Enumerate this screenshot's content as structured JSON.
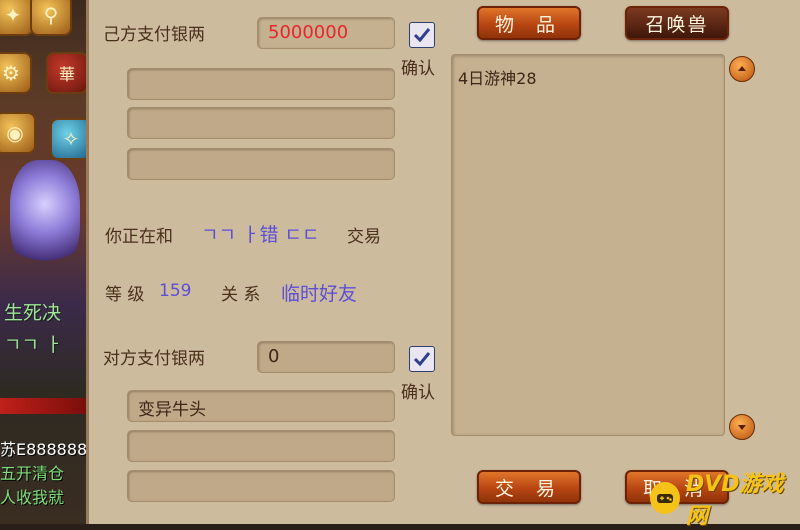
{
  "scene": {
    "text_shengsi": "生死决",
    "text_marks": "ㄱㄱ ㅏ",
    "chat_line1": "苏E888888",
    "chat_line2": "五开清仓",
    "chat_line3": "人收我就",
    "icons": [
      "bag-icon",
      "search-icon",
      "gear-icon",
      "ornament-icon",
      "orb-icon",
      "pet-icon"
    ]
  },
  "trade": {
    "my_silver_label": "己方支付银两",
    "my_silver_value": "5000000",
    "my_confirm_label": "确认",
    "my_confirm_checked": true,
    "trading_with_prefix": "你正在和",
    "partner_name": "ㄱㄱ ㅏ错 ㄷㄷ",
    "trading_with_suffix": "交易",
    "level_label": "等 级",
    "level_value": "159",
    "relation_label": "关 系",
    "relation_value": "临时好友",
    "their_silver_label": "对方支付银两",
    "their_silver_value": "0",
    "their_confirm_label": "确认",
    "their_confirm_checked": true,
    "their_items": [
      "变异牛头",
      "",
      ""
    ],
    "my_items": [
      "",
      "",
      ""
    ]
  },
  "tabs": {
    "items": "物 品",
    "summon": "召唤兽"
  },
  "list": {
    "entries": [
      "4日游神28"
    ]
  },
  "buttons": {
    "trade": "交 易",
    "cancel": "取 消"
  },
  "watermark": {
    "text": "DVD游戏网"
  },
  "colors": {
    "money_red": "#e8262b",
    "accent_purple": "#5d4ed6",
    "button_orange": "#c24e16",
    "panel_bg": "#cdbb9e"
  }
}
